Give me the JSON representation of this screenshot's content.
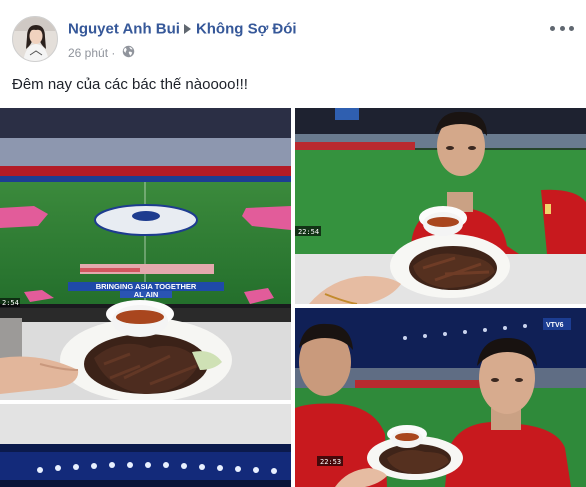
{
  "post": {
    "author": "Nguyet Anh Bui",
    "group": "Không Sợ Đói",
    "time": "26 phút",
    "separator": "·",
    "privacy_icon": "globe-icon",
    "text": "Đêm nay của các bác thế nàoooo!!!"
  },
  "photos": {
    "stadium_banner": "BRINGING ASIA TOGETHER",
    "stadium_subbanner": "AL AIN",
    "stadium_clock": "2:54",
    "player_clock": "22:54",
    "closeup_clock": "22:53",
    "channel_logo": "VTV6"
  },
  "colors": {
    "name_link": "#365899",
    "meta_gray": "#90949c",
    "pitch_green": "#2f8a3a",
    "jersey_red": "#c8191e"
  }
}
